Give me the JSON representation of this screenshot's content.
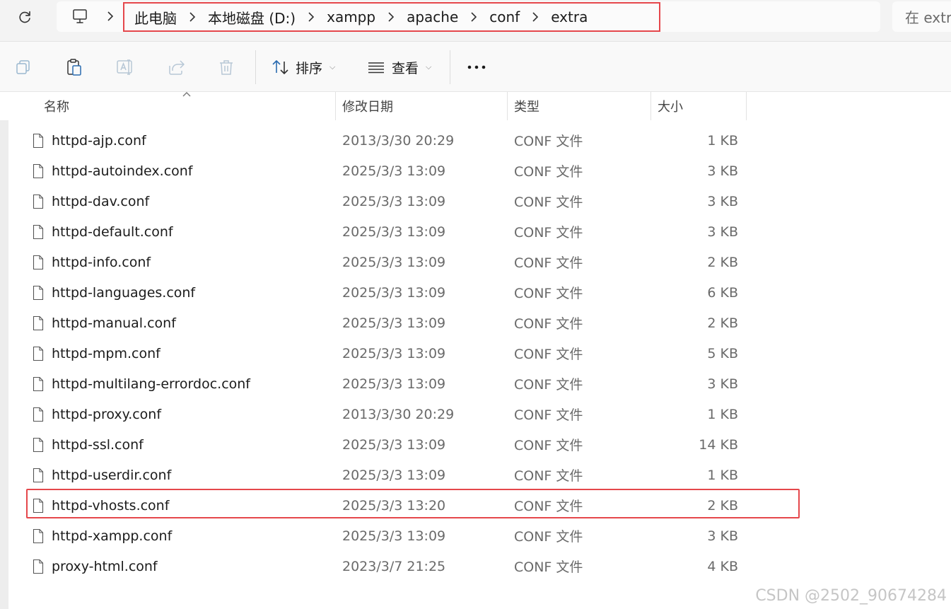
{
  "address_bar": {
    "breadcrumbs": [
      "此电脑",
      "本地磁盘 (D:)",
      "xampp",
      "apache",
      "conf",
      "extra"
    ],
    "search_placeholder": "在 extra"
  },
  "toolbar": {
    "sort_label": "排序",
    "view_label": "查看"
  },
  "columns": {
    "name": "名称",
    "date": "修改日期",
    "type": "类型",
    "size": "大小"
  },
  "files": [
    {
      "name": "httpd-ajp.conf",
      "date": "2013/3/30 20:29",
      "type": "CONF 文件",
      "size": "1 KB"
    },
    {
      "name": "httpd-autoindex.conf",
      "date": "2025/3/3 13:09",
      "type": "CONF 文件",
      "size": "3 KB"
    },
    {
      "name": "httpd-dav.conf",
      "date": "2025/3/3 13:09",
      "type": "CONF 文件",
      "size": "3 KB"
    },
    {
      "name": "httpd-default.conf",
      "date": "2025/3/3 13:09",
      "type": "CONF 文件",
      "size": "3 KB"
    },
    {
      "name": "httpd-info.conf",
      "date": "2025/3/3 13:09",
      "type": "CONF 文件",
      "size": "2 KB"
    },
    {
      "name": "httpd-languages.conf",
      "date": "2025/3/3 13:09",
      "type": "CONF 文件",
      "size": "6 KB"
    },
    {
      "name": "httpd-manual.conf",
      "date": "2025/3/3 13:09",
      "type": "CONF 文件",
      "size": "2 KB"
    },
    {
      "name": "httpd-mpm.conf",
      "date": "2025/3/3 13:09",
      "type": "CONF 文件",
      "size": "5 KB"
    },
    {
      "name": "httpd-multilang-errordoc.conf",
      "date": "2025/3/3 13:09",
      "type": "CONF 文件",
      "size": "3 KB"
    },
    {
      "name": "httpd-proxy.conf",
      "date": "2013/3/30 20:29",
      "type": "CONF 文件",
      "size": "1 KB"
    },
    {
      "name": "httpd-ssl.conf",
      "date": "2025/3/3 13:09",
      "type": "CONF 文件",
      "size": "14 KB"
    },
    {
      "name": "httpd-userdir.conf",
      "date": "2025/3/3 13:09",
      "type": "CONF 文件",
      "size": "1 KB"
    },
    {
      "name": "httpd-vhosts.conf",
      "date": "2025/3/3 13:20",
      "type": "CONF 文件",
      "size": "2 KB"
    },
    {
      "name": "httpd-xampp.conf",
      "date": "2025/3/3 13:09",
      "type": "CONF 文件",
      "size": "3 KB"
    },
    {
      "name": "proxy-html.conf",
      "date": "2023/3/7 21:25",
      "type": "CONF 文件",
      "size": "4 KB"
    }
  ],
  "watermark": "CSDN @2502_90674284",
  "colors": {
    "highlight": "#e5474b"
  }
}
